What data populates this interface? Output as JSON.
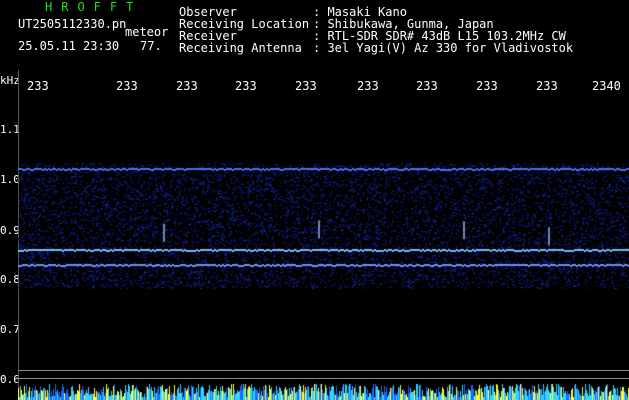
{
  "header": {
    "title": "HROFFT",
    "file_name": "UT2505112330.pn",
    "meteor_label": "meteor",
    "timestamp": "25.05.11 23:30",
    "meteor_count": "77.",
    "rows": [
      {
        "label": "Observer",
        "value": ": Masaki Kano"
      },
      {
        "label": "Receiving Location",
        "value": ": Shibukawa, Gunma, Japan"
      },
      {
        "label": "Receiver",
        "value": ": RTL-SDR SDR# 43dB L15 103.2MHz CW"
      },
      {
        "label": "Receiving Antenna",
        "value": ": 3el Yagi(V) Az 330 for Vladivostok"
      }
    ]
  },
  "axis": {
    "unit": "kHz",
    "y_ticks": [
      "1.1",
      "1.0",
      "0.9",
      "0.8",
      "0.7",
      "0.6"
    ],
    "x_ticks": [
      "233",
      "233",
      "233",
      "233",
      "233",
      "233",
      "233",
      "233",
      "233",
      "2340"
    ]
  },
  "colors": {
    "title": "#16e316",
    "text": "#ffffff",
    "background": "#000000",
    "signal": "#3a5cff",
    "strip_yellow": "#ffff33",
    "strip_cyan": "#33d6ff"
  }
}
